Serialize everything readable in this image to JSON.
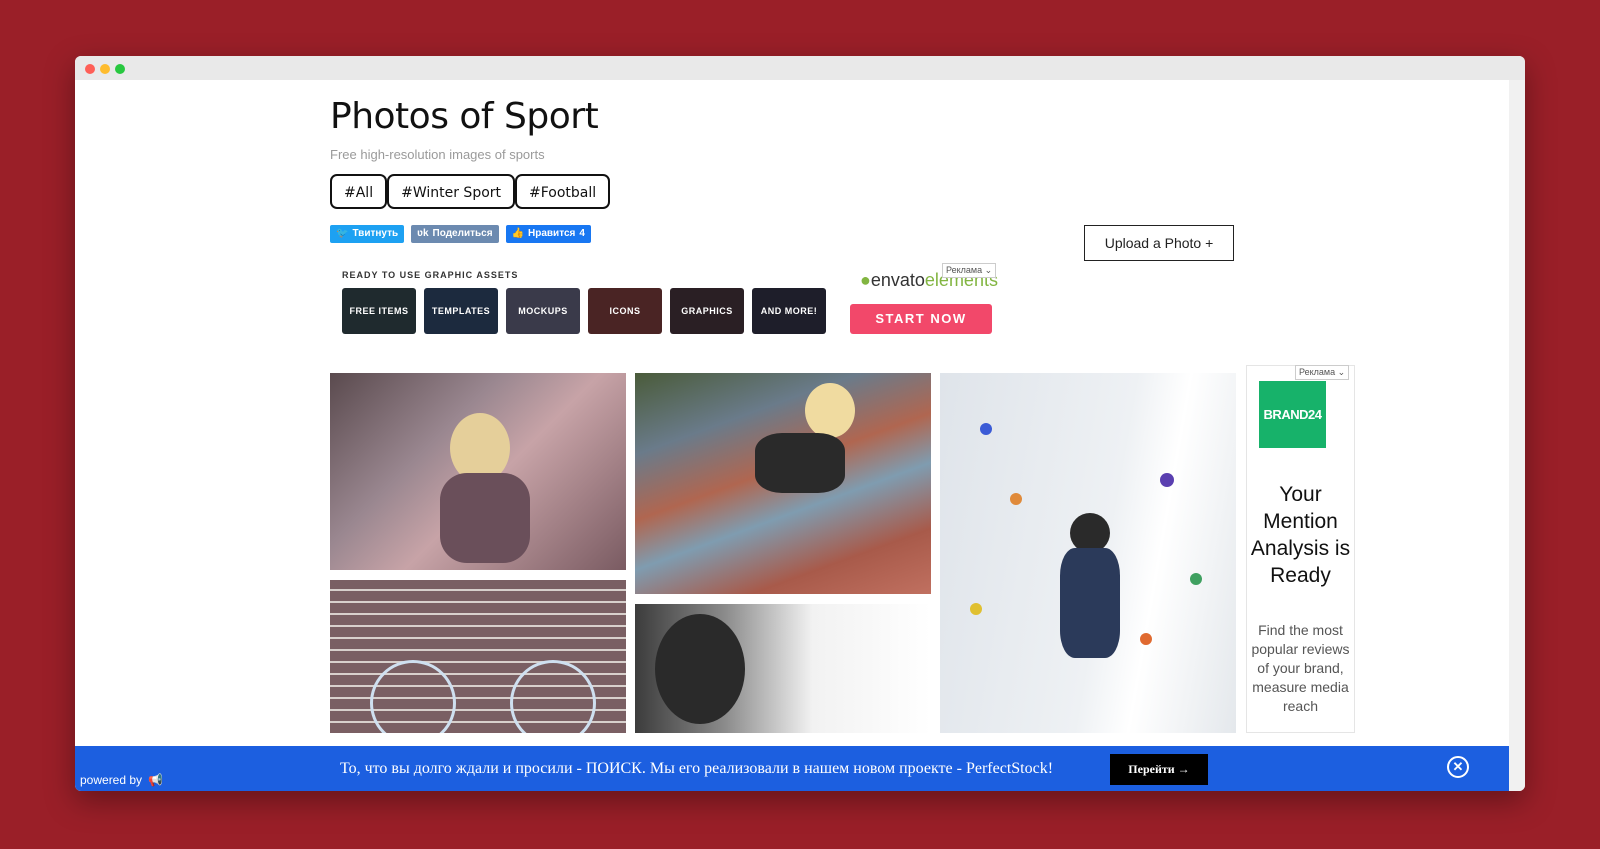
{
  "page": {
    "title": "Photos of Sport",
    "subtitle": "Free high-resolution images of sports"
  },
  "tags": [
    "#All",
    "#Winter Sport",
    "#Football"
  ],
  "share": {
    "twitter": "Твитнуть",
    "vk": "Поделиться",
    "facebook": "Нравится",
    "facebook_count": "4"
  },
  "upload_button": "Upload a Photo +",
  "envato_ad": {
    "heading": "READY TO USE GRAPHIC ASSETS",
    "tiles": [
      "FREE ITEMS",
      "TEMPLATES",
      "MOCKUPS",
      "ICONS",
      "GRAPHICS",
      "AND MORE!"
    ],
    "tile_colors": [
      "#1f2a2e",
      "#1c2a3e",
      "#3a3a4a",
      "#4a2424",
      "#2a1f24",
      "#1e1e2a"
    ],
    "logo_left": "envato",
    "logo_right": "elements",
    "cta": "START NOW",
    "ad_label": "Реклама"
  },
  "side_ad": {
    "ad_label": "Реклама",
    "brand": "BRAND24",
    "headline": "Your Mention Analysis is Ready",
    "body": "Find the most popular reviews of your brand, measure media reach"
  },
  "bottom_bar": {
    "powered_by": "powered by",
    "message": "То, что вы долго ждали и просили - ПОИСК. Мы его реализовали в нашем новом проекте - PerfectStock!",
    "button": "Перейти →",
    "close": "✕"
  },
  "colors": {
    "background": "#9a1f28",
    "bar_blue": "#1c5fe0",
    "start_now": "#f2486a",
    "brand24": "#17b26a"
  }
}
